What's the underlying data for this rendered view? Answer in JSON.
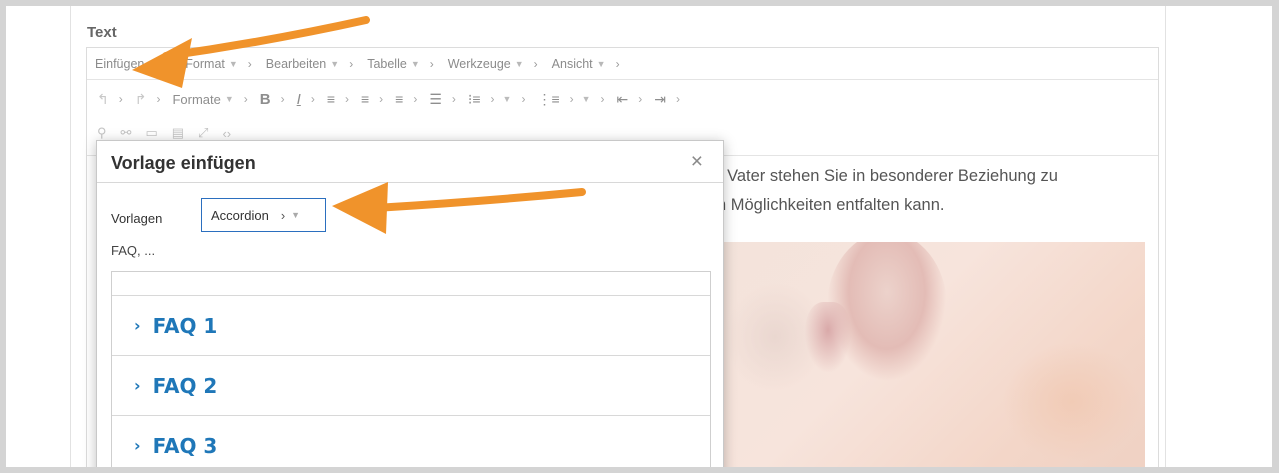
{
  "field": {
    "label": "Text"
  },
  "menubar": {
    "items": [
      {
        "label": "Einfügen"
      },
      {
        "label": "Format"
      },
      {
        "label": "Bearbeiten"
      },
      {
        "label": "Tabelle"
      },
      {
        "label": "Werkzeuge"
      },
      {
        "label": "Ansicht"
      }
    ]
  },
  "toolbar": {
    "formats_label": "Formate",
    "bold_label": "B",
    "italic_label": "I"
  },
  "content": {
    "line1": "r Vater stehen Sie in besonderer Beziehung zu",
    "line2": "n Möglichkeiten entfalten kann."
  },
  "dialog": {
    "title": "Vorlage einfügen",
    "close_label": "×",
    "templates_label": "Vorlagen",
    "templates_selected": "Accordion",
    "description": "FAQ, ...",
    "preview_items": [
      {
        "label": "FAQ 1"
      },
      {
        "label": "FAQ 2"
      },
      {
        "label": "FAQ 3"
      }
    ]
  },
  "colors": {
    "accent_arrow": "#f0932b",
    "link_blue": "#1f77b8",
    "select_border": "#2b6fbf"
  }
}
